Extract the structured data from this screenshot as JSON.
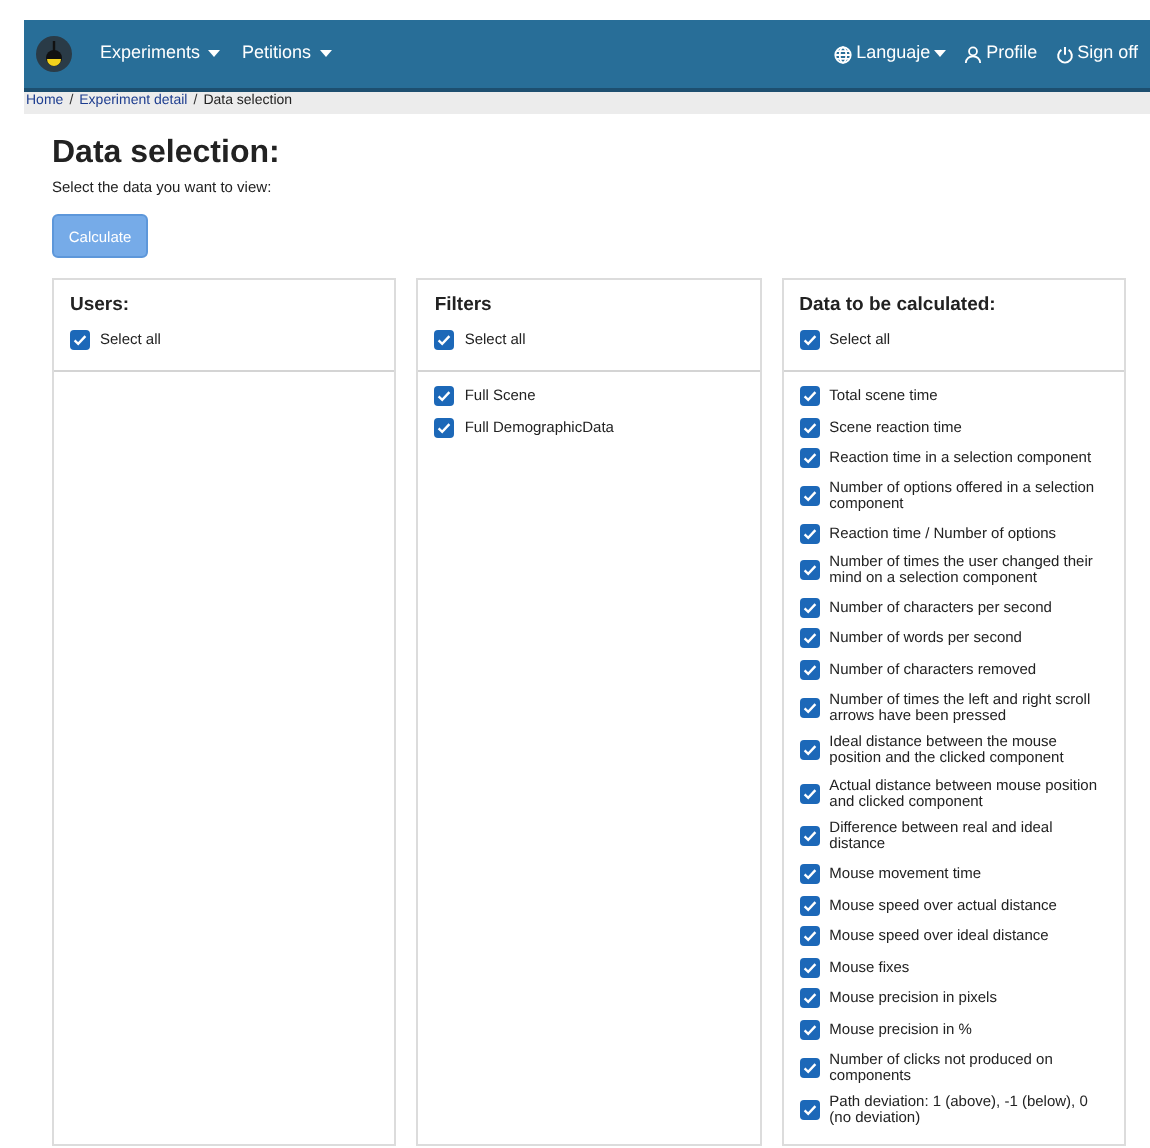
{
  "navbar": {
    "menus": [
      {
        "label": "Experiments"
      },
      {
        "label": "Petitions"
      }
    ],
    "right": [
      {
        "kind": "language",
        "label": "Languaje"
      },
      {
        "kind": "profile",
        "label": "Profile"
      },
      {
        "kind": "signoff",
        "label": "Sign off"
      }
    ]
  },
  "breadcrumb": [
    {
      "label": "Home",
      "link": true,
      "separator": "/"
    },
    {
      "label": "Experiment detail",
      "link": true,
      "separator": "/"
    },
    {
      "label": "Data selection",
      "link": false
    }
  ],
  "heading": "Data selection:",
  "subtitle": "Select the data you want to view:",
  "calculate_button": {
    "label": "Calculate",
    "disabled": true
  },
  "panels": [
    {
      "title": "Users:",
      "select_all": {
        "label": "Select all",
        "checked": true
      }
    },
    {
      "title": "Filters",
      "select_all": {
        "label": "Select all",
        "checked": true
      },
      "items": [
        {
          "label": "Full Scene",
          "checked": true
        },
        {
          "label": "Full DemographicData",
          "checked": true
        }
      ]
    },
    {
      "title": "Data to be calculated:",
      "select_all": {
        "label": "Select all",
        "checked": true
      },
      "items": [
        {
          "label": "Total scene time",
          "checked": true
        },
        {
          "label": "Scene reaction time",
          "checked": true
        },
        {
          "label": "Reaction time in a selection component",
          "checked": true
        },
        {
          "label": "Number of options offered in a selection component",
          "checked": true
        },
        {
          "label": "Reaction time / Number of options",
          "checked": true
        },
        {
          "label": "Number of times the user changed their mind on a selection component",
          "checked": true
        },
        {
          "label": "Number of characters per second",
          "checked": true
        },
        {
          "label": "Number of words per second",
          "checked": true
        },
        {
          "label": "Number of characters removed",
          "checked": true
        },
        {
          "label": "Number of times the left and right scroll arrows have been pressed",
          "checked": true
        },
        {
          "label": "Ideal distance between the mouse position and the clicked component",
          "checked": true
        },
        {
          "label": "Actual distance between mouse position and clicked component",
          "checked": true
        },
        {
          "label": "Difference between real and ideal distance",
          "checked": true
        },
        {
          "label": "Mouse movement time",
          "checked": true
        },
        {
          "label": "Mouse speed over actual distance",
          "checked": true
        },
        {
          "label": "Mouse speed over ideal distance",
          "checked": true
        },
        {
          "label": "Mouse fixes",
          "checked": true
        },
        {
          "label": "Mouse precision in pixels",
          "checked": true
        },
        {
          "label": "Mouse precision in %",
          "checked": true
        },
        {
          "label": "Number of clicks not produced on components",
          "checked": true
        },
        {
          "label": "Path deviation: 1 (above), -1 (below), 0 (no deviation)",
          "checked": true
        }
      ]
    }
  ]
}
